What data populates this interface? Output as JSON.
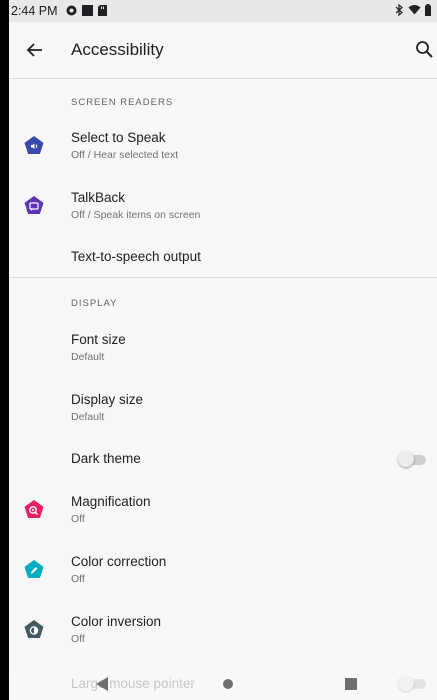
{
  "status_bar": {
    "time": "2:44 PM",
    "icons_left": [
      "circle-badge-icon",
      "black-square-icon",
      "sd-card-icon"
    ],
    "icons_right": [
      "bluetooth-icon",
      "wifi-icon",
      "battery-icon"
    ]
  },
  "app_bar": {
    "title": "Accessibility",
    "back_icon": "arrow-back-icon",
    "search_icon": "search-icon"
  },
  "sections": {
    "screen_readers": {
      "header": "SCREEN READERS",
      "items": [
        {
          "title": "Select to Speak",
          "subtitle": "Off / Hear selected text",
          "icon": "select-to-speak-icon",
          "icon_color": "#3949ab"
        },
        {
          "title": "TalkBack",
          "subtitle": "Off / Speak items on screen",
          "icon": "talkback-icon",
          "icon_color": "#5e35b1"
        },
        {
          "title": "Text-to-speech output"
        }
      ]
    },
    "display": {
      "header": "DISPLAY",
      "items": [
        {
          "title": "Font size",
          "subtitle": "Default"
        },
        {
          "title": "Display size",
          "subtitle": "Default"
        },
        {
          "title": "Dark theme",
          "toggle": false
        },
        {
          "title": "Magnification",
          "subtitle": "Off",
          "icon": "magnification-icon",
          "icon_color": "#e91e63"
        },
        {
          "title": "Color correction",
          "subtitle": "Off",
          "icon": "color-correction-icon",
          "icon_color": "#00acc1"
        },
        {
          "title": "Color inversion",
          "subtitle": "Off",
          "icon": "color-inversion-icon",
          "icon_color": "#455a64"
        },
        {
          "title": "Large mouse pointer",
          "toggle": false
        }
      ]
    }
  },
  "nav_bar": {
    "back": "nav-back-icon",
    "home": "nav-home-icon",
    "recents": "nav-recents-icon"
  },
  "colors": {
    "background": "#f7f7f7",
    "status_bar": "#e8e8e8",
    "divider": "#dadce0"
  }
}
